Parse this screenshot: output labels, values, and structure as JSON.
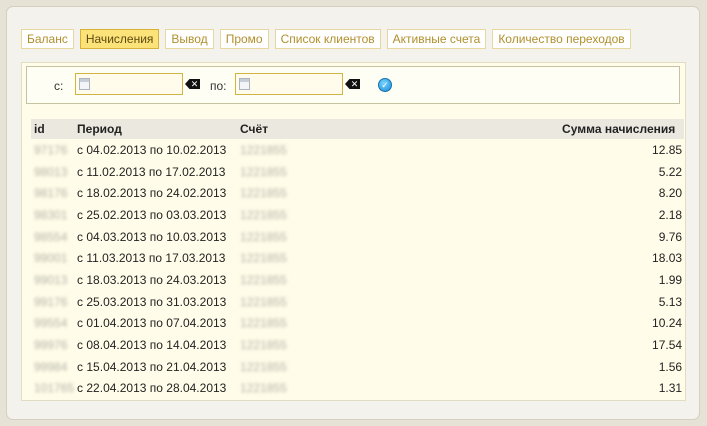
{
  "tabs": [
    {
      "label": "Баланс",
      "active": false
    },
    {
      "label": "Начисления",
      "active": true
    },
    {
      "label": "Вывод",
      "active": false
    },
    {
      "label": "Промо",
      "active": false
    },
    {
      "label": "Список клиентов",
      "active": false
    },
    {
      "label": "Активные счета",
      "active": false
    },
    {
      "label": "Количество переходов",
      "active": false
    }
  ],
  "filter": {
    "from_label": "с:",
    "to_label": "по:",
    "from_value": "",
    "to_value": ""
  },
  "table": {
    "headers": {
      "id": "id",
      "period": "Период",
      "account": "Счёт",
      "sum": "Сумма начисления"
    },
    "rows": [
      {
        "id": "97176",
        "period": "с 04.02.2013 по 10.02.2013",
        "account": "1221855",
        "sum": "12.85"
      },
      {
        "id": "98013",
        "period": "с 11.02.2013 по 17.02.2013",
        "account": "1221855",
        "sum": "5.22"
      },
      {
        "id": "98176",
        "period": "с 18.02.2013 по 24.02.2013",
        "account": "1221855",
        "sum": "8.20"
      },
      {
        "id": "98301",
        "period": "с 25.02.2013 по 03.03.2013",
        "account": "1221855",
        "sum": "2.18"
      },
      {
        "id": "98554",
        "period": "с 04.03.2013 по 10.03.2013",
        "account": "1221855",
        "sum": "9.76"
      },
      {
        "id": "99001",
        "period": "с 11.03.2013 по 17.03.2013",
        "account": "1221855",
        "sum": "18.03"
      },
      {
        "id": "99013",
        "period": "с 18.03.2013 по 24.03.2013",
        "account": "1221855",
        "sum": "1.99"
      },
      {
        "id": "99176",
        "period": "с 25.03.2013 по 31.03.2013",
        "account": "1221855",
        "sum": "5.13"
      },
      {
        "id": "99554",
        "period": "с 01.04.2013 по 07.04.2013",
        "account": "1221855",
        "sum": "10.24"
      },
      {
        "id": "99976",
        "period": "с 08.04.2013 по 14.04.2013",
        "account": "1221855",
        "sum": "17.54"
      },
      {
        "id": "99984",
        "period": "с 15.04.2013 по 21.04.2013",
        "account": "1221855",
        "sum": "1.56"
      },
      {
        "id": "101765",
        "period": "с 22.04.2013 по 28.04.2013",
        "account": "1221855",
        "sum": "1.31"
      }
    ]
  }
}
